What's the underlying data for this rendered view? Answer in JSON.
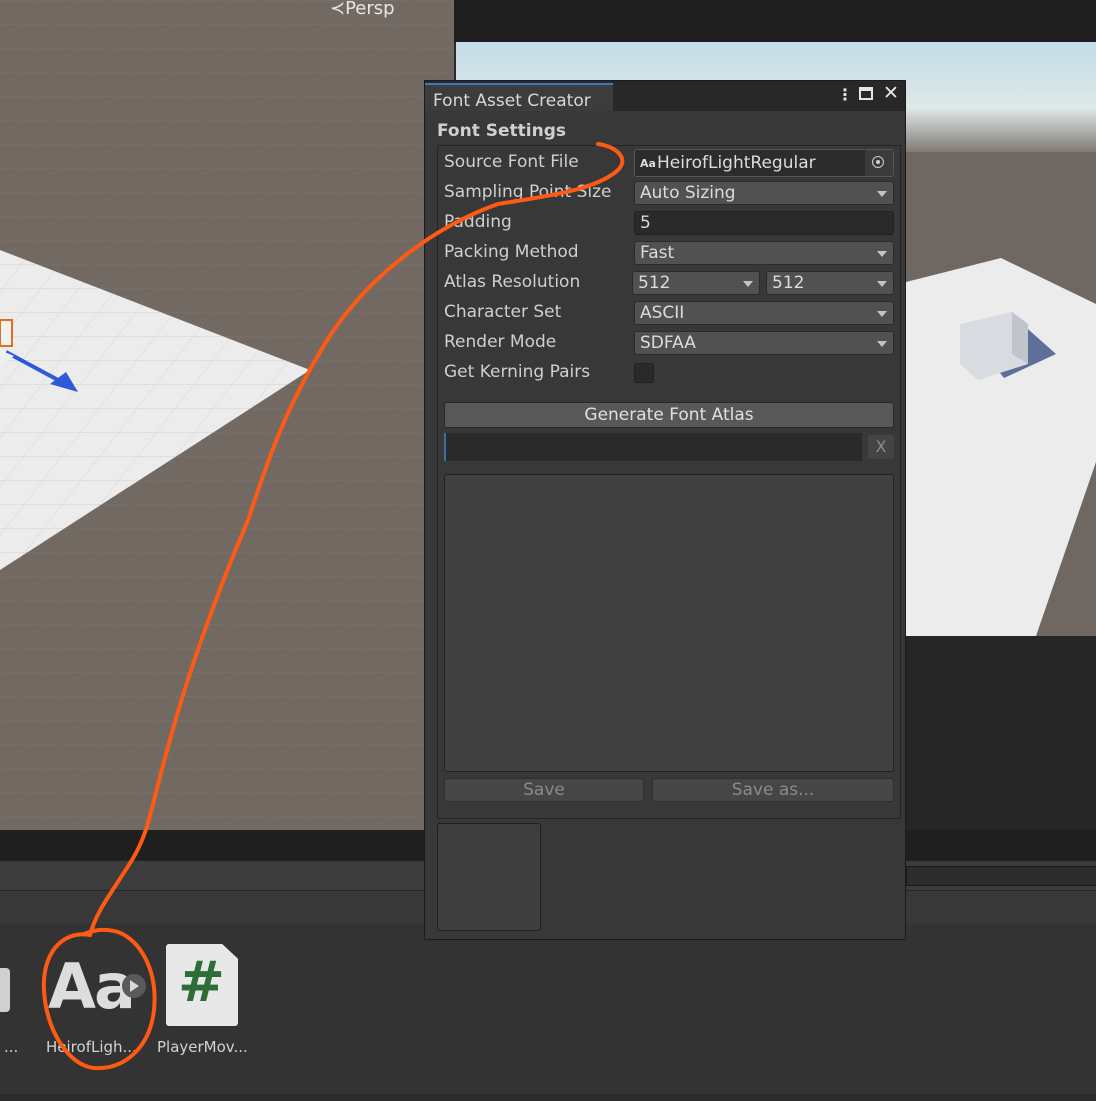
{
  "scene": {
    "camera_label": "≺Persp"
  },
  "font_asset_creator": {
    "tab_title": "Font Asset Creator",
    "section_title": "Font Settings",
    "fields": {
      "source_font_file": {
        "label": "Source Font File",
        "value": "HeirofLightRegular",
        "icon_text": "Aa"
      },
      "sampling_point_size": {
        "label": "Sampling Point Size",
        "value": "Auto Sizing"
      },
      "padding": {
        "label": "Padding",
        "value": "5"
      },
      "packing_method": {
        "label": "Packing Method",
        "value": "Fast"
      },
      "atlas_resolution": {
        "label": "Atlas Resolution",
        "width": "512",
        "height": "512"
      },
      "character_set": {
        "label": "Character Set",
        "value": "ASCII"
      },
      "render_mode": {
        "label": "Render Mode",
        "value": "SDFAA"
      },
      "get_kerning_pairs": {
        "label": "Get Kerning Pairs",
        "checked": false
      }
    },
    "generate_button": "Generate Font Atlas",
    "clear_button": "X",
    "save_button": "Save",
    "save_as_button": "Save as..."
  },
  "project": {
    "assets": [
      {
        "label": "...",
        "icon": "folder-icon"
      },
      {
        "label": "HeirofLigh...",
        "icon": "font-asset-icon",
        "icon_text": "Aa"
      },
      {
        "label": "PlayerMov...",
        "icon": "csharp-script-icon",
        "icon_text": "#"
      }
    ]
  },
  "annotation": {
    "color": "#ff5a14"
  }
}
